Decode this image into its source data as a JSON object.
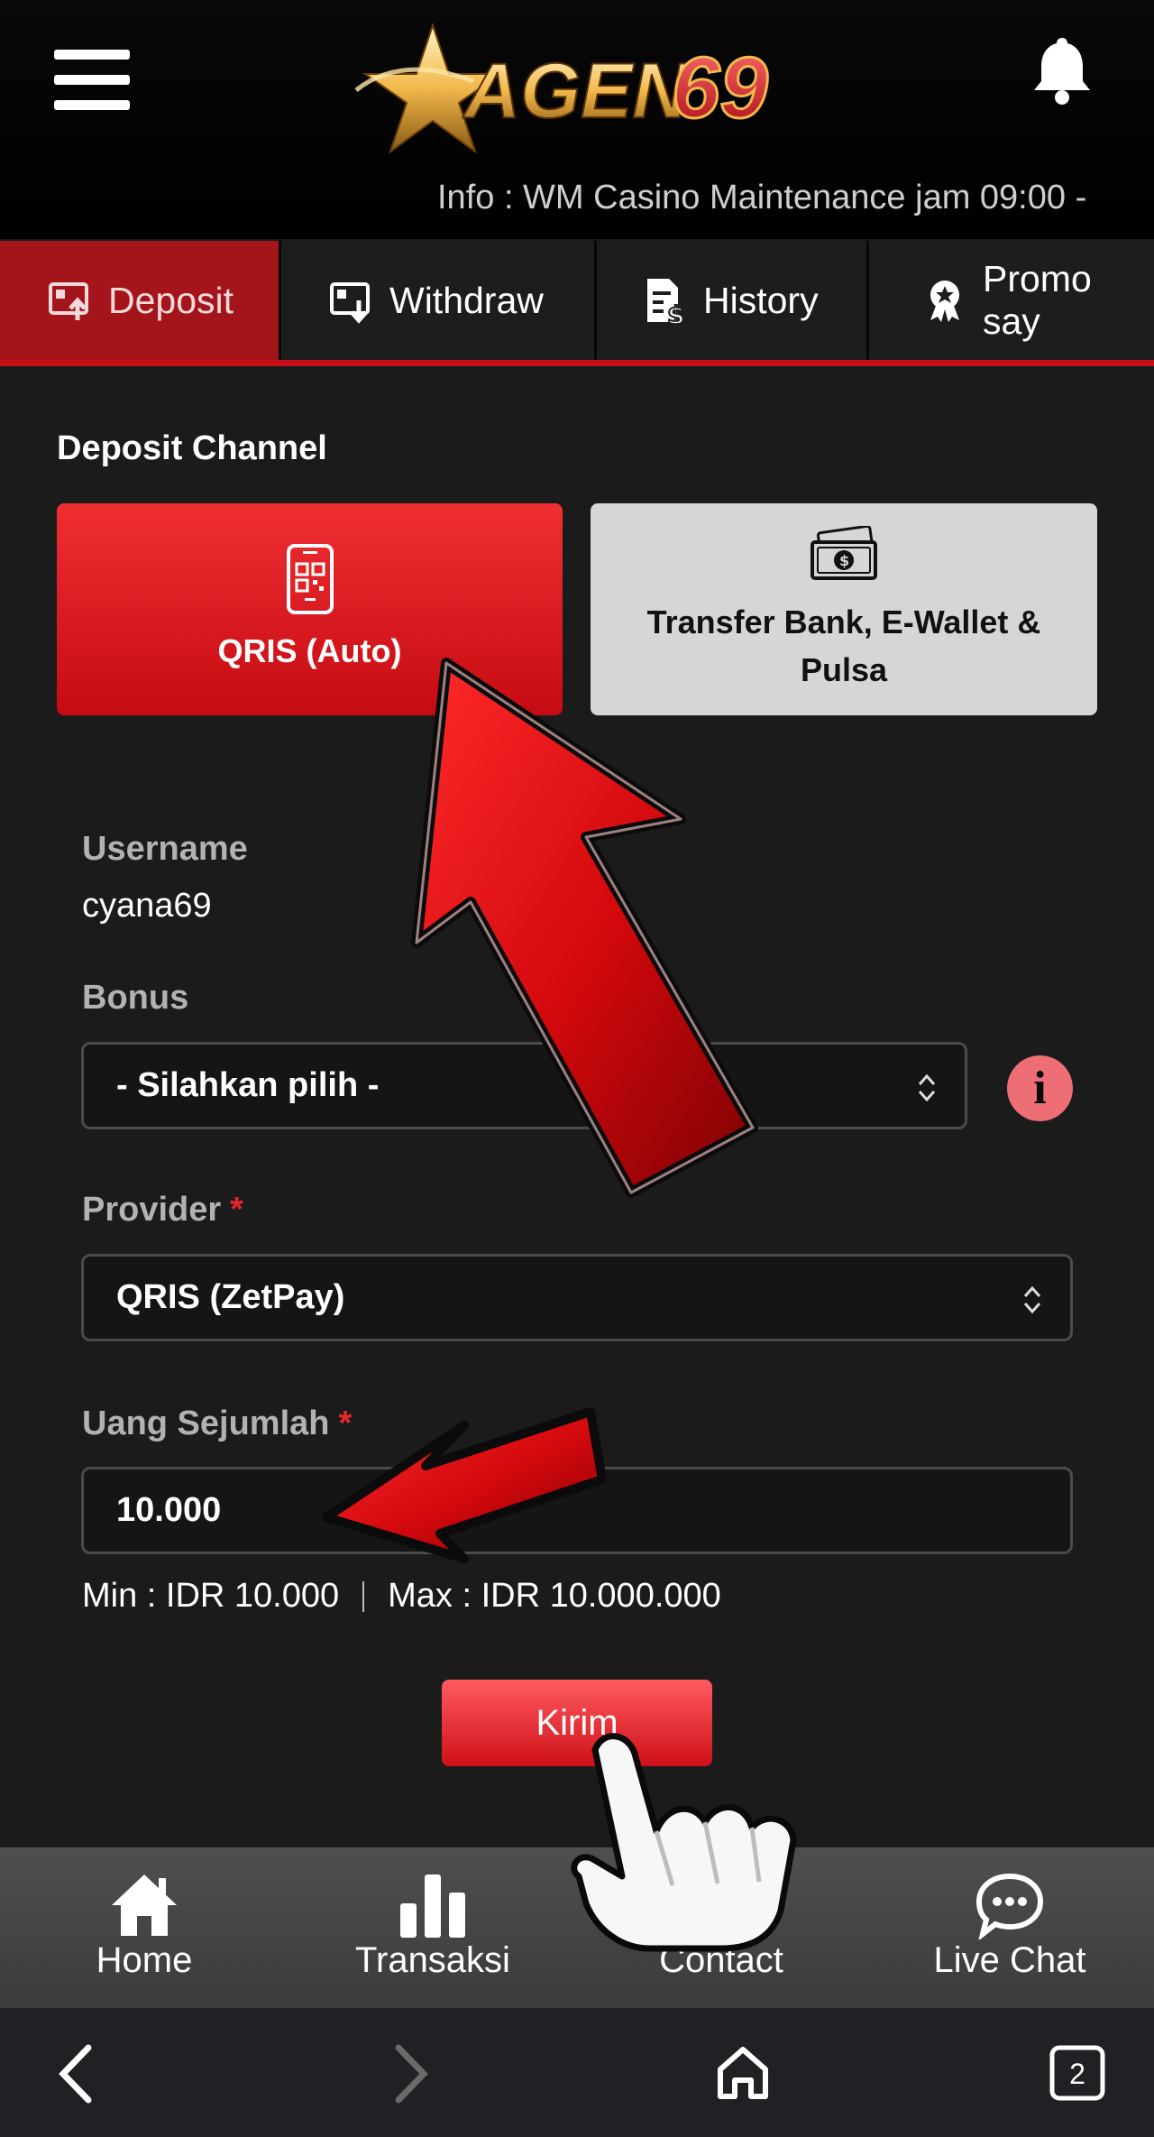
{
  "header": {
    "logo_text_main": "AGEN",
    "logo_text_accent": "69",
    "ticker": "Info : WM Casino Maintenance jam 09:00 -"
  },
  "tabs": [
    {
      "label": "Deposit",
      "icon": "deposit-icon",
      "active": true
    },
    {
      "label": "Withdraw",
      "icon": "withdraw-icon",
      "active": false
    },
    {
      "label": "History",
      "icon": "history-icon",
      "active": false
    },
    {
      "label": "Promo say",
      "icon": "promo-icon",
      "active": false
    }
  ],
  "deposit": {
    "channel_title": "Deposit Channel",
    "channels": [
      {
        "label": "QRIS (Auto)",
        "icon": "qris-phone-icon",
        "selected": true
      },
      {
        "label": "Transfer Bank, E-Wallet & Pulsa",
        "icon": "money-icon",
        "selected": false
      }
    ],
    "username_label": "Username",
    "username_value": "cyana69",
    "bonus_label": "Bonus",
    "bonus_selected": "- Silahkan pilih -",
    "provider_label": "Provider",
    "provider_required": "*",
    "provider_selected": "QRIS (ZetPay)",
    "amount_label": "Uang Sejumlah",
    "amount_required": "*",
    "amount_value": "10.000",
    "min_text": "Min : IDR 10.000",
    "max_text": "Max : IDR 10.000.000",
    "submit_label": "Kirim",
    "info_symbol": "i"
  },
  "bottom_nav": [
    {
      "label": "Home",
      "icon": "home-icon"
    },
    {
      "label": "Transaksi",
      "icon": "bar-chart-icon"
    },
    {
      "label": "Contact",
      "icon": "contact-icon"
    },
    {
      "label": "Live Chat",
      "icon": "chat-icon"
    }
  ],
  "browser": {
    "tab_count": "2"
  },
  "colors": {
    "accent_red": "#c40d17",
    "active_tab": "#a4141b",
    "background": "#1b1b1c",
    "logo_gold": "#f2b84b"
  }
}
